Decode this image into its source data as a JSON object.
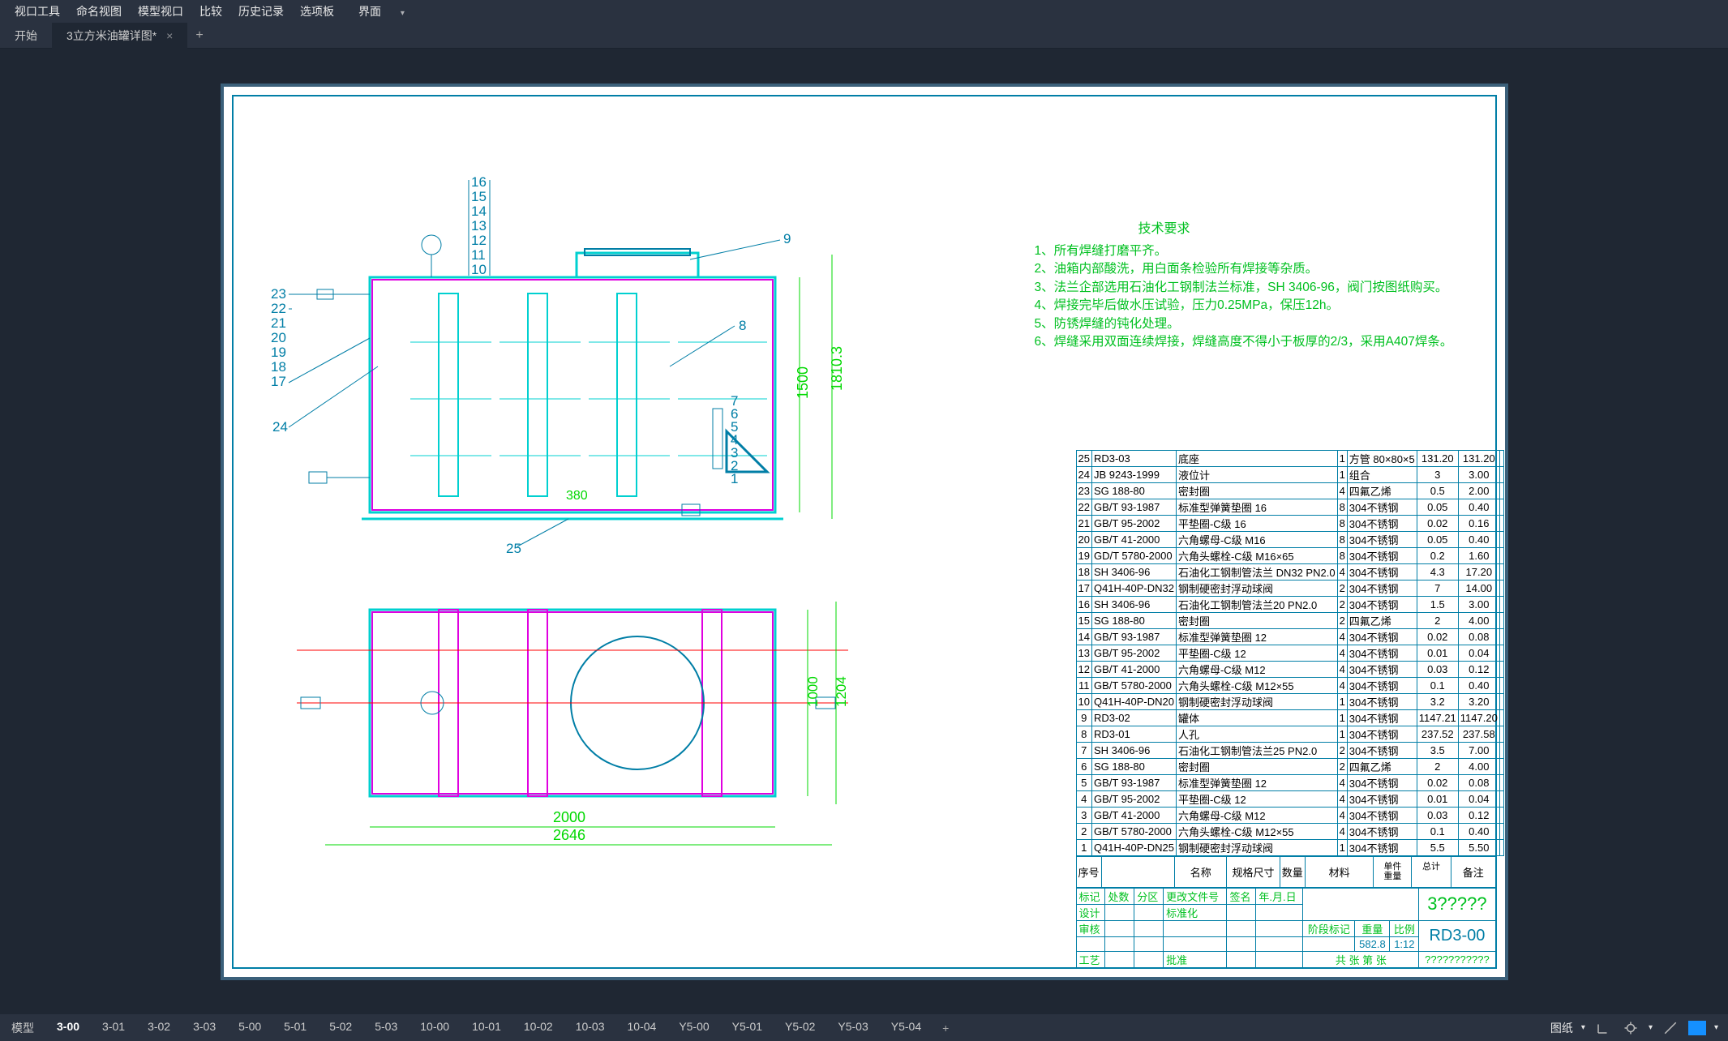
{
  "menubar": {
    "items": [
      "视口工具",
      "命名视图",
      "模型视口",
      "比较",
      "历史记录",
      "选项板",
      "界面"
    ]
  },
  "tabs": {
    "start": "开始",
    "active": "3立方米油罐详图*",
    "add": "+"
  },
  "tech_req": {
    "title": "技术要求",
    "lines": [
      "1、所有焊缝打磨平齐。",
      "2、油箱内部酸洗，用白面条检验所有焊接等杂质。",
      "3、法兰企部选用石油化工钢制法兰标准，SH 3406-96，阀门按图纸购买。",
      "4、焊接完毕后做水压试验，压力0.25MPa，保压12h。",
      "5、防锈焊缝的钝化处理。",
      "6、焊缝采用双面连续焊接，焊缝高度不得小于板厚的2/3，采用A407焊条。"
    ]
  },
  "bom_header": {
    "seq": "序号",
    "name": "名称",
    "spec": "规格尺寸",
    "qty": "数量",
    "mat": "材料",
    "unit": "单件",
    "total": "总计",
    "mass": "重量",
    "remark": "备注"
  },
  "bom": [
    {
      "n": "25",
      "std": "RD3-03",
      "name": "底座",
      "qty": "1",
      "mat": "方管 80×80×5",
      "u": "131.20",
      "t": "131.20"
    },
    {
      "n": "24",
      "std": "JB 9243-1999",
      "name": "液位计",
      "qty": "1",
      "mat": "组合",
      "u": "3",
      "t": "3.00"
    },
    {
      "n": "23",
      "std": "SG 188-80",
      "name": "密封圈",
      "qty": "4",
      "mat": "四氟乙烯",
      "u": "0.5",
      "t": "2.00"
    },
    {
      "n": "22",
      "std": "GB/T 93-1987",
      "name": "标准型弹簧垫圈 16",
      "qty": "8",
      "mat": "304不锈钢",
      "u": "0.05",
      "t": "0.40"
    },
    {
      "n": "21",
      "std": "GB/T 95-2002",
      "name": "平垫圈-C级 16",
      "qty": "8",
      "mat": "304不锈钢",
      "u": "0.02",
      "t": "0.16"
    },
    {
      "n": "20",
      "std": "GB/T 41-2000",
      "name": "六角螺母-C级 M16",
      "qty": "8",
      "mat": "304不锈钢",
      "u": "0.05",
      "t": "0.40"
    },
    {
      "n": "19",
      "std": "GD/T 5780-2000",
      "name": "六角头螺栓-C级 M16×65",
      "qty": "8",
      "mat": "304不锈钢",
      "u": "0.2",
      "t": "1.60"
    },
    {
      "n": "18",
      "std": "SH 3406-96",
      "name": "石油化工钢制管法兰 DN32 PN2.0",
      "qty": "4",
      "mat": "304不锈钢",
      "u": "4.3",
      "t": "17.20"
    },
    {
      "n": "17",
      "std": "Q41H-40P-DN32",
      "name": "钢制硬密封浮动球阀",
      "qty": "2",
      "mat": "304不锈钢",
      "u": "7",
      "t": "14.00"
    },
    {
      "n": "16",
      "std": "SH 3406-96",
      "name": "石油化工钢制管法兰20 PN2.0",
      "qty": "2",
      "mat": "304不锈钢",
      "u": "1.5",
      "t": "3.00"
    },
    {
      "n": "15",
      "std": "SG 188-80",
      "name": "密封圈",
      "qty": "2",
      "mat": "四氟乙烯",
      "u": "2",
      "t": "4.00"
    },
    {
      "n": "14",
      "std": "GB/T 93-1987",
      "name": "标准型弹簧垫圈 12",
      "qty": "4",
      "mat": "304不锈钢",
      "u": "0.02",
      "t": "0.08"
    },
    {
      "n": "13",
      "std": "GB/T 95-2002",
      "name": "平垫圈-C级 12",
      "qty": "4",
      "mat": "304不锈钢",
      "u": "0.01",
      "t": "0.04"
    },
    {
      "n": "12",
      "std": "GB/T 41-2000",
      "name": "六角螺母-C级 M12",
      "qty": "4",
      "mat": "304不锈钢",
      "u": "0.03",
      "t": "0.12"
    },
    {
      "n": "11",
      "std": "GB/T 5780-2000",
      "name": "六角头螺栓-C级 M12×55",
      "qty": "4",
      "mat": "304不锈钢",
      "u": "0.1",
      "t": "0.40"
    },
    {
      "n": "10",
      "std": "Q41H-40P-DN20",
      "name": "钢制硬密封浮动球阀",
      "qty": "1",
      "mat": "304不锈钢",
      "u": "3.2",
      "t": "3.20"
    },
    {
      "n": "9",
      "std": "RD3-02",
      "name": "罐体",
      "qty": "1",
      "mat": "304不锈钢",
      "u": "1147.21",
      "t": "1147.20"
    },
    {
      "n": "8",
      "std": "RD3-01",
      "name": "人孔",
      "qty": "1",
      "mat": "304不锈钢",
      "u": "237.52",
      "t": "237.58"
    },
    {
      "n": "7",
      "std": "SH 3406-96",
      "name": "石油化工钢制管法兰25 PN2.0",
      "qty": "2",
      "mat": "304不锈钢",
      "u": "3.5",
      "t": "7.00"
    },
    {
      "n": "6",
      "std": "SG 188-80",
      "name": "密封圈",
      "qty": "2",
      "mat": "四氟乙烯",
      "u": "2",
      "t": "4.00"
    },
    {
      "n": "5",
      "std": "GB/T 93-1987",
      "name": "标准型弹簧垫圈 12",
      "qty": "4",
      "mat": "304不锈钢",
      "u": "0.02",
      "t": "0.08"
    },
    {
      "n": "4",
      "std": "GB/T 95-2002",
      "name": "平垫圈-C级 12",
      "qty": "4",
      "mat": "304不锈钢",
      "u": "0.01",
      "t": "0.04"
    },
    {
      "n": "3",
      "std": "GB/T 41-2000",
      "name": "六角螺母-C级 M12",
      "qty": "4",
      "mat": "304不锈钢",
      "u": "0.03",
      "t": "0.12"
    },
    {
      "n": "2",
      "std": "GB/T 5780-2000",
      "name": "六角头螺栓-C级 M12×55",
      "qty": "4",
      "mat": "304不锈钢",
      "u": "0.1",
      "t": "0.40"
    },
    {
      "n": "1",
      "std": "Q41H-40P-DN25",
      "name": "钢制硬密封浮动球阀",
      "qty": "1",
      "mat": "304不锈钢",
      "u": "5.5",
      "t": "5.50"
    }
  ],
  "titleblock": {
    "row1": [
      "标记",
      "处数",
      "分区",
      "更改文件号",
      "签名",
      "年.月.日"
    ],
    "row2": [
      "设计",
      "",
      "",
      "标准化",
      "",
      ""
    ],
    "row3": [
      "审核"
    ],
    "row4": [
      "工艺",
      "",
      "",
      "批准"
    ],
    "right_top": [
      "阶段标记",
      "重量",
      "比例"
    ],
    "right_mid": [
      "",
      "582.8",
      "1:12"
    ],
    "proj": "3?????",
    "code": "RD3-00",
    "sheet": "共  张  第  张",
    "company": "???????????"
  },
  "layout_tabs": [
    "模型",
    "3-00",
    "3-01",
    "3-02",
    "3-03",
    "5-00",
    "5-01",
    "5-02",
    "5-03",
    "10-00",
    "10-01",
    "10-02",
    "10-03",
    "10-04",
    "Y5-00",
    "Y5-01",
    "Y5-02",
    "Y5-03",
    "Y5-04"
  ],
  "active_layout": "3-00",
  "status_right": {
    "label": "图纸"
  },
  "drawing": {
    "callouts_left_upper": [
      "23",
      "22",
      "21",
      "20",
      "19",
      "18",
      "17"
    ],
    "callouts_center_stack": [
      "16",
      "15",
      "14",
      "13",
      "12",
      "11",
      "10"
    ],
    "callouts_right_small": [
      "7",
      "6",
      "5",
      "4",
      "3",
      "2",
      "1"
    ],
    "callout_24": "24",
    "callout_25": "25",
    "callout_8": "8",
    "callout_9": "9",
    "dims": {
      "w": "2000",
      "w2": "2646",
      "h": "1500",
      "h2": "1810.3",
      "ph": "1000",
      "ph2": "1204",
      "mid": "380"
    }
  }
}
